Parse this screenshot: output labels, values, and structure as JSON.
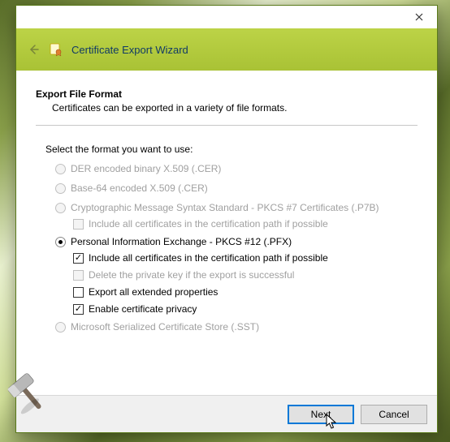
{
  "window": {
    "title": "Certificate Export Wizard"
  },
  "main": {
    "step_title": "Export File Format",
    "step_desc": "Certificates can be exported in a variety of file formats.",
    "prompt": "Select the format you want to use:",
    "options": {
      "der": "DER encoded binary X.509 (.CER)",
      "base64": "Base-64 encoded X.509 (.CER)",
      "pkcs7": "Cryptographic Message Syntax Standard - PKCS #7 Certificates (.P7B)",
      "pkcs7_include": "Include all certificates in the certification path if possible",
      "pfx": "Personal Information Exchange - PKCS #12 (.PFX)",
      "pfx_include": "Include all certificates in the certification path if possible",
      "pfx_delete": "Delete the private key if the export is successful",
      "pfx_ext": "Export all extended properties",
      "pfx_privacy": "Enable certificate privacy",
      "sst": "Microsoft Serialized Certificate Store (.SST)"
    }
  },
  "footer": {
    "next": "Next",
    "cancel": "Cancel"
  }
}
